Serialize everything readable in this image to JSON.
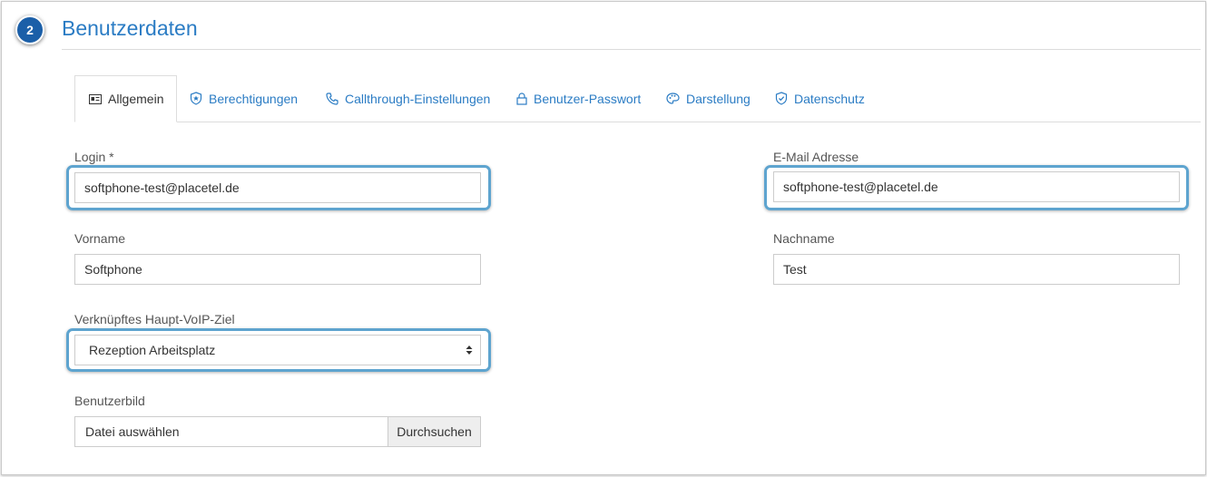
{
  "header": {
    "step_number": "2",
    "title": "Benutzerdaten"
  },
  "tabs": [
    {
      "label": "Allgemein",
      "icon": "id-card-icon",
      "active": true
    },
    {
      "label": "Berechtigungen",
      "icon": "shield-star-icon",
      "active": false
    },
    {
      "label": "Callthrough-Einstellungen",
      "icon": "phone-icon",
      "active": false
    },
    {
      "label": "Benutzer-Passwort",
      "icon": "lock-icon",
      "active": false
    },
    {
      "label": "Darstellung",
      "icon": "palette-icon",
      "active": false
    },
    {
      "label": "Datenschutz",
      "icon": "shield-check-icon",
      "active": false
    }
  ],
  "form": {
    "login": {
      "label": "Login *",
      "value": "softphone-test@placetel.de"
    },
    "email": {
      "label": "E-Mail Adresse",
      "value": "softphone-test@placetel.de"
    },
    "vorname": {
      "label": "Vorname",
      "value": "Softphone"
    },
    "nachname": {
      "label": "Nachname",
      "value": "Test"
    },
    "voip_target": {
      "label": "Verknüpftes Haupt-VoIP-Ziel",
      "selected": "Rezeption Arbeitsplatz"
    },
    "picture": {
      "label": "Benutzerbild",
      "placeholder": "Datei auswählen",
      "button": "Durchsuchen"
    }
  },
  "colors": {
    "accent": "#2b7cc4",
    "badge": "#1b5fa8",
    "highlight": "#5ea4cf"
  }
}
